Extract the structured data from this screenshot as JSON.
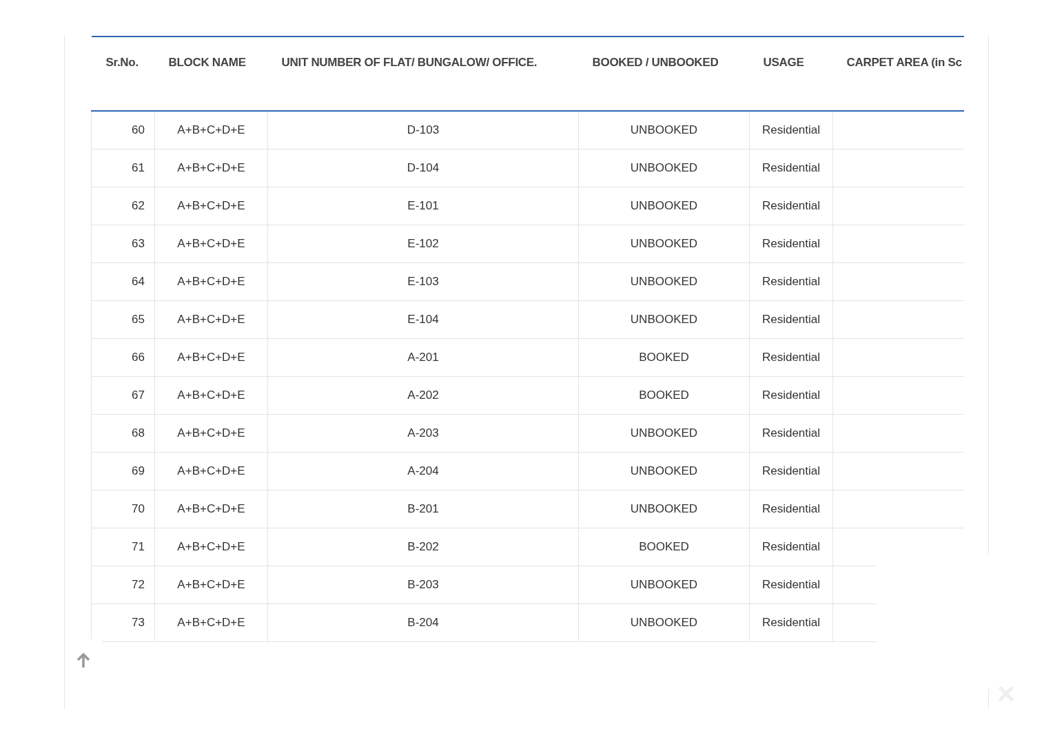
{
  "table": {
    "columns": [
      "Sr.No.",
      "BLOCK NAME",
      "UNIT NUMBER OF FLAT/ BUNGALOW/ OFFICE.",
      "BOOKED / UNBOOKED",
      "USAGE",
      "CARPET AREA (in Sc"
    ],
    "rows": [
      {
        "sr_no": "60",
        "block_name": "A+B+C+D+E",
        "unit_number": "D-103",
        "booking_status": "UNBOOKED",
        "usage": "Residential"
      },
      {
        "sr_no": "61",
        "block_name": "A+B+C+D+E",
        "unit_number": "D-104",
        "booking_status": "UNBOOKED",
        "usage": "Residential"
      },
      {
        "sr_no": "62",
        "block_name": "A+B+C+D+E",
        "unit_number": "E-101",
        "booking_status": "UNBOOKED",
        "usage": "Residential"
      },
      {
        "sr_no": "63",
        "block_name": "A+B+C+D+E",
        "unit_number": "E-102",
        "booking_status": "UNBOOKED",
        "usage": "Residential"
      },
      {
        "sr_no": "64",
        "block_name": "A+B+C+D+E",
        "unit_number": "E-103",
        "booking_status": "UNBOOKED",
        "usage": "Residential"
      },
      {
        "sr_no": "65",
        "block_name": "A+B+C+D+E",
        "unit_number": "E-104",
        "booking_status": "UNBOOKED",
        "usage": "Residential"
      },
      {
        "sr_no": "66",
        "block_name": "A+B+C+D+E",
        "unit_number": "A-201",
        "booking_status": "BOOKED",
        "usage": "Residential"
      },
      {
        "sr_no": "67",
        "block_name": "A+B+C+D+E",
        "unit_number": "A-202",
        "booking_status": "BOOKED",
        "usage": "Residential"
      },
      {
        "sr_no": "68",
        "block_name": "A+B+C+D+E",
        "unit_number": "A-203",
        "booking_status": "UNBOOKED",
        "usage": "Residential"
      },
      {
        "sr_no": "69",
        "block_name": "A+B+C+D+E",
        "unit_number": "A-204",
        "booking_status": "UNBOOKED",
        "usage": "Residential"
      },
      {
        "sr_no": "70",
        "block_name": "A+B+C+D+E",
        "unit_number": "B-201",
        "booking_status": "UNBOOKED",
        "usage": "Residential"
      },
      {
        "sr_no": "71",
        "block_name": "A+B+C+D+E",
        "unit_number": "B-202",
        "booking_status": "BOOKED",
        "usage": "Residential"
      },
      {
        "sr_no": "72",
        "block_name": "A+B+C+D+E",
        "unit_number": "B-203",
        "booking_status": "UNBOOKED",
        "usage": "Residential"
      },
      {
        "sr_no": "73",
        "block_name": "A+B+C+D+E",
        "unit_number": "B-204",
        "booking_status": "UNBOOKED",
        "usage": "Residential"
      }
    ]
  }
}
